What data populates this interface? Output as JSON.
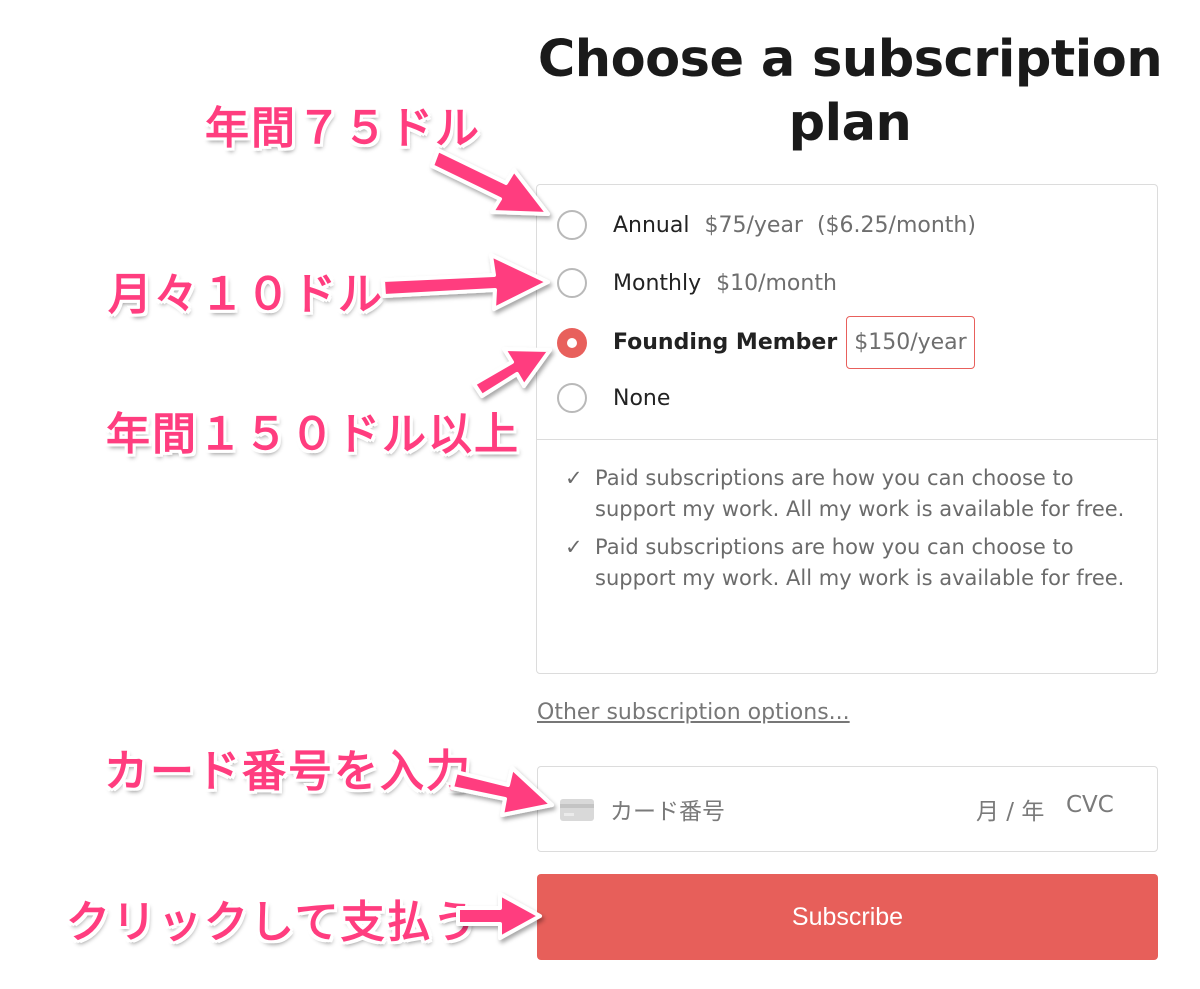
{
  "title": "Choose a subscription plan",
  "plans": [
    {
      "name": "Annual",
      "price": "$75/year",
      "extra": "($6.25/month)",
      "selected": false
    },
    {
      "name": "Monthly",
      "price": "$10/month",
      "selected": false
    },
    {
      "name": "Founding Member",
      "price": "$150/year",
      "selected": true
    },
    {
      "name": "None",
      "selected": false
    }
  ],
  "benefits": [
    {
      "icon": "checkmark-icon",
      "text": "Paid subscriptions are how you can choose to support my work. All my work is available for free."
    },
    {
      "icon": "checkmark-icon",
      "text": "Paid subscriptions are how you can choose to support my work. All my work is available for free."
    }
  ],
  "other_options_link": "Other subscription options...",
  "card": {
    "icon": "credit-card-icon",
    "number_placeholder": "カード番号",
    "expiry_placeholder": "月 / 年",
    "cvc_placeholder": "CVC"
  },
  "subscribe_label": "Subscribe",
  "annotations": {
    "annual": "年間７５ドル",
    "monthly": "月々１０ドル",
    "founding": "年間１５０ドル以上",
    "card": "カード番号を入力",
    "subscribe": "クリックして支払う"
  },
  "colors": {
    "accent": "#e75f5a",
    "annotation": "#ff3d7f",
    "border": "#dcdcdc"
  }
}
